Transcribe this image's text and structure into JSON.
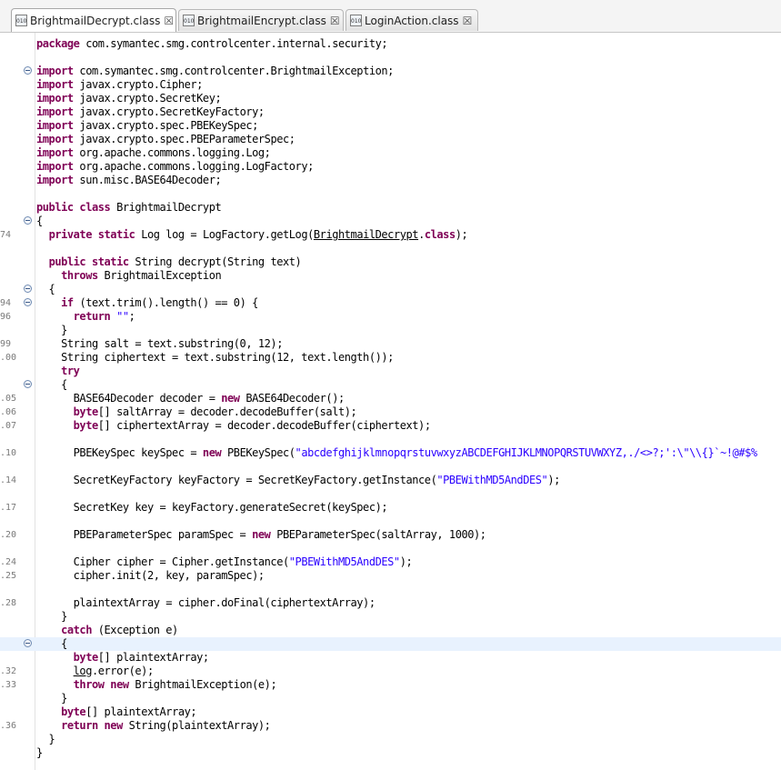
{
  "tabs": [
    {
      "label": "BrightmailDecrypt.class",
      "icon": "class-file-icon",
      "close": "☒"
    },
    {
      "label": "BrightmailEncrypt.class",
      "icon": "class-file-icon",
      "close": "☒"
    },
    {
      "label": "LoginAction.class",
      "icon": "class-file-icon",
      "close": "☒"
    }
  ],
  "file_icon_text": "010",
  "colors": {
    "keyword": "#7f0055",
    "string": "#2a00ff",
    "line_highlight": "#e8f2fe"
  },
  "lines": [
    {
      "n": "",
      "fold": false,
      "tokens": [
        {
          "t": "kw",
          "v": "package"
        },
        {
          "t": "",
          "v": " com.symantec.smg.controlcenter.internal.security;"
        }
      ]
    },
    {
      "n": "",
      "fold": false,
      "tokens": []
    },
    {
      "n": "",
      "fold": true,
      "tokens": [
        {
          "t": "kw",
          "v": "import"
        },
        {
          "t": "",
          "v": " com.symantec.smg.controlcenter.BrightmailException;"
        }
      ]
    },
    {
      "n": "",
      "fold": false,
      "tokens": [
        {
          "t": "kw",
          "v": "import"
        },
        {
          "t": "",
          "v": " javax.crypto.Cipher;"
        }
      ]
    },
    {
      "n": "",
      "fold": false,
      "tokens": [
        {
          "t": "kw",
          "v": "import"
        },
        {
          "t": "",
          "v": " javax.crypto.SecretKey;"
        }
      ]
    },
    {
      "n": "",
      "fold": false,
      "tokens": [
        {
          "t": "kw",
          "v": "import"
        },
        {
          "t": "",
          "v": " javax.crypto.SecretKeyFactory;"
        }
      ]
    },
    {
      "n": "",
      "fold": false,
      "tokens": [
        {
          "t": "kw",
          "v": "import"
        },
        {
          "t": "",
          "v": " javax.crypto.spec.PBEKeySpec;"
        }
      ]
    },
    {
      "n": "",
      "fold": false,
      "tokens": [
        {
          "t": "kw",
          "v": "import"
        },
        {
          "t": "",
          "v": " javax.crypto.spec.PBEParameterSpec;"
        }
      ]
    },
    {
      "n": "",
      "fold": false,
      "tokens": [
        {
          "t": "kw",
          "v": "import"
        },
        {
          "t": "",
          "v": " org.apache.commons.logging.Log;"
        }
      ]
    },
    {
      "n": "",
      "fold": false,
      "tokens": [
        {
          "t": "kw",
          "v": "import"
        },
        {
          "t": "",
          "v": " org.apache.commons.logging.LogFactory;"
        }
      ]
    },
    {
      "n": "",
      "fold": false,
      "tokens": [
        {
          "t": "kw",
          "v": "import"
        },
        {
          "t": "",
          "v": " sun.misc.BASE64Decoder;"
        }
      ]
    },
    {
      "n": "",
      "fold": false,
      "tokens": []
    },
    {
      "n": "",
      "fold": false,
      "tokens": [
        {
          "t": "kw",
          "v": "public class"
        },
        {
          "t": "",
          "v": " BrightmailDecrypt"
        }
      ]
    },
    {
      "n": "",
      "fold": true,
      "tokens": [
        {
          "t": "",
          "v": "{"
        }
      ]
    },
    {
      "n": "74",
      "fold": false,
      "tokens": [
        {
          "t": "",
          "v": "  "
        },
        {
          "t": "kw",
          "v": "private static"
        },
        {
          "t": "",
          "v": " Log log = LogFactory.getLog("
        },
        {
          "t": "ul",
          "v": "BrightmailDecrypt"
        },
        {
          "t": "",
          "v": "."
        },
        {
          "t": "kw",
          "v": "class"
        },
        {
          "t": "",
          "v": ");"
        }
      ]
    },
    {
      "n": "",
      "fold": false,
      "tokens": []
    },
    {
      "n": "",
      "fold": false,
      "tokens": [
        {
          "t": "",
          "v": "  "
        },
        {
          "t": "kw",
          "v": "public static"
        },
        {
          "t": "",
          "v": " String decrypt(String text)"
        }
      ]
    },
    {
      "n": "",
      "fold": false,
      "tokens": [
        {
          "t": "",
          "v": "    "
        },
        {
          "t": "kw",
          "v": "throws"
        },
        {
          "t": "",
          "v": " BrightmailException"
        }
      ]
    },
    {
      "n": "",
      "fold": true,
      "tokens": [
        {
          "t": "",
          "v": "  {"
        }
      ]
    },
    {
      "n": "94",
      "fold": true,
      "tokens": [
        {
          "t": "",
          "v": "    "
        },
        {
          "t": "kw",
          "v": "if"
        },
        {
          "t": "",
          "v": " (text.trim().length() == 0) {"
        }
      ]
    },
    {
      "n": "96",
      "fold": false,
      "tokens": [
        {
          "t": "",
          "v": "      "
        },
        {
          "t": "kw",
          "v": "return"
        },
        {
          "t": "",
          "v": " "
        },
        {
          "t": "str",
          "v": "\"\""
        },
        {
          "t": "",
          "v": ";"
        }
      ]
    },
    {
      "n": "",
      "fold": false,
      "tokens": [
        {
          "t": "",
          "v": "    }"
        }
      ]
    },
    {
      "n": "99",
      "fold": false,
      "tokens": [
        {
          "t": "",
          "v": "    String salt = text.substring(0, 12);"
        }
      ]
    },
    {
      "n": ".00",
      "fold": false,
      "tokens": [
        {
          "t": "",
          "v": "    String ciphertext = text.substring(12, text.length());"
        }
      ]
    },
    {
      "n": "",
      "fold": false,
      "tokens": [
        {
          "t": "",
          "v": "    "
        },
        {
          "t": "kw",
          "v": "try"
        }
      ]
    },
    {
      "n": "",
      "fold": true,
      "tokens": [
        {
          "t": "",
          "v": "    {"
        }
      ]
    },
    {
      "n": ".05",
      "fold": false,
      "tokens": [
        {
          "t": "",
          "v": "      BASE64Decoder decoder = "
        },
        {
          "t": "kw",
          "v": "new"
        },
        {
          "t": "",
          "v": " BASE64Decoder();"
        }
      ]
    },
    {
      "n": ".06",
      "fold": false,
      "tokens": [
        {
          "t": "",
          "v": "      "
        },
        {
          "t": "kw",
          "v": "byte"
        },
        {
          "t": "",
          "v": "[] saltArray = decoder.decodeBuffer(salt);"
        }
      ]
    },
    {
      "n": ".07",
      "fold": false,
      "tokens": [
        {
          "t": "",
          "v": "      "
        },
        {
          "t": "kw",
          "v": "byte"
        },
        {
          "t": "",
          "v": "[] ciphertextArray = decoder.decodeBuffer(ciphertext);"
        }
      ]
    },
    {
      "n": "",
      "fold": false,
      "tokens": []
    },
    {
      "n": ".10",
      "fold": false,
      "tokens": [
        {
          "t": "",
          "v": "      PBEKeySpec keySpec = "
        },
        {
          "t": "kw",
          "v": "new"
        },
        {
          "t": "",
          "v": " PBEKeySpec("
        },
        {
          "t": "str",
          "v": "\"abcdefghijklmnopqrstuvwxyzABCDEFGHIJKLMNOPQRSTUVWXYZ,./<>?;':\\\"\\\\{}`~!@#$%"
        }
      ]
    },
    {
      "n": "",
      "fold": false,
      "tokens": []
    },
    {
      "n": ".14",
      "fold": false,
      "tokens": [
        {
          "t": "",
          "v": "      SecretKeyFactory keyFactory = SecretKeyFactory.getInstance("
        },
        {
          "t": "str",
          "v": "\"PBEWithMD5AndDES\""
        },
        {
          "t": "",
          "v": ");"
        }
      ]
    },
    {
      "n": "",
      "fold": false,
      "tokens": []
    },
    {
      "n": ".17",
      "fold": false,
      "tokens": [
        {
          "t": "",
          "v": "      SecretKey key = keyFactory.generateSecret(keySpec);"
        }
      ]
    },
    {
      "n": "",
      "fold": false,
      "tokens": []
    },
    {
      "n": ".20",
      "fold": false,
      "tokens": [
        {
          "t": "",
          "v": "      PBEParameterSpec paramSpec = "
        },
        {
          "t": "kw",
          "v": "new"
        },
        {
          "t": "",
          "v": " PBEParameterSpec(saltArray, 1000);"
        }
      ]
    },
    {
      "n": "",
      "fold": false,
      "tokens": []
    },
    {
      "n": ".24",
      "fold": false,
      "tokens": [
        {
          "t": "",
          "v": "      Cipher cipher = Cipher.getInstance("
        },
        {
          "t": "str",
          "v": "\"PBEWithMD5AndDES\""
        },
        {
          "t": "",
          "v": ");"
        }
      ]
    },
    {
      "n": ".25",
      "fold": false,
      "tokens": [
        {
          "t": "",
          "v": "      cipher.init(2, key, paramSpec);"
        }
      ]
    },
    {
      "n": "",
      "fold": false,
      "tokens": []
    },
    {
      "n": ".28",
      "fold": false,
      "tokens": [
        {
          "t": "",
          "v": "      plaintextArray = cipher.doFinal(ciphertextArray);"
        }
      ]
    },
    {
      "n": "",
      "fold": false,
      "tokens": [
        {
          "t": "",
          "v": "    }"
        }
      ]
    },
    {
      "n": "",
      "fold": false,
      "tokens": [
        {
          "t": "",
          "v": "    "
        },
        {
          "t": "kw",
          "v": "catch"
        },
        {
          "t": "",
          "v": " (Exception e)"
        }
      ]
    },
    {
      "n": "",
      "fold": true,
      "highlight": true,
      "tokens": [
        {
          "t": "",
          "v": "    {"
        }
      ]
    },
    {
      "n": "",
      "fold": false,
      "tokens": [
        {
          "t": "",
          "v": "      "
        },
        {
          "t": "kw",
          "v": "byte"
        },
        {
          "t": "",
          "v": "[] plaintextArray;"
        }
      ]
    },
    {
      "n": ".32",
      "fold": false,
      "tokens": [
        {
          "t": "",
          "v": "      "
        },
        {
          "t": "ul",
          "v": "log"
        },
        {
          "t": "",
          "v": ".error(e);"
        }
      ]
    },
    {
      "n": ".33",
      "fold": false,
      "tokens": [
        {
          "t": "",
          "v": "      "
        },
        {
          "t": "kw",
          "v": "throw new"
        },
        {
          "t": "",
          "v": " BrightmailException(e);"
        }
      ]
    },
    {
      "n": "",
      "fold": false,
      "tokens": [
        {
          "t": "",
          "v": "    }"
        }
      ]
    },
    {
      "n": "",
      "fold": false,
      "tokens": [
        {
          "t": "",
          "v": "    "
        },
        {
          "t": "kw",
          "v": "byte"
        },
        {
          "t": "",
          "v": "[] plaintextArray;"
        }
      ]
    },
    {
      "n": ".36",
      "fold": false,
      "tokens": [
        {
          "t": "",
          "v": "    "
        },
        {
          "t": "kw",
          "v": "return new"
        },
        {
          "t": "",
          "v": " String(plaintextArray);"
        }
      ]
    },
    {
      "n": "",
      "fold": false,
      "tokens": [
        {
          "t": "",
          "v": "  }"
        }
      ]
    },
    {
      "n": "",
      "fold": false,
      "tokens": [
        {
          "t": "",
          "v": "}"
        }
      ]
    }
  ]
}
